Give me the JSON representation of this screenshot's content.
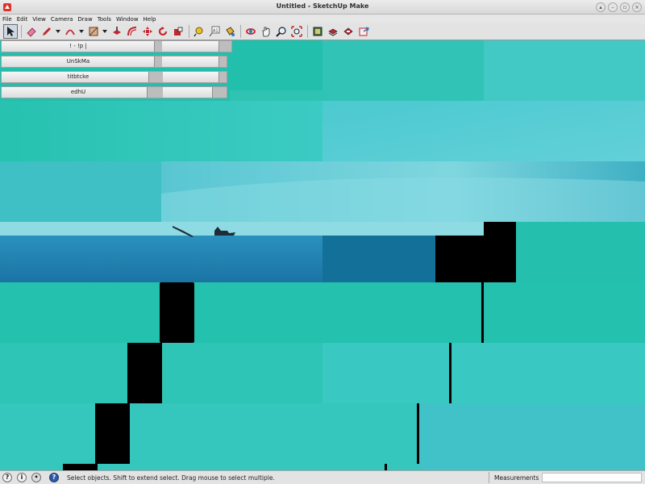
{
  "window": {
    "title": "Untitled - SketchUp Make",
    "icon": "sketchup-logo-icon",
    "buttons": [
      "up-icon",
      "minimize-icon",
      "maximize-icon",
      "close-icon"
    ]
  },
  "menu": [
    "File",
    "Edit",
    "View",
    "Camera",
    "Draw",
    "Tools",
    "Window",
    "Help"
  ],
  "toolbar": {
    "tools": [
      {
        "name": "select-tool-button",
        "icon": "arrow-icon",
        "active": true
      },
      {
        "name": "eraser-tool-button",
        "icon": "eraser-icon"
      },
      {
        "name": "pencil-tool-button",
        "icon": "pencil-icon",
        "dropdown": true
      },
      {
        "name": "arc-tool-button",
        "icon": "arc-icon",
        "dropdown": true
      },
      {
        "name": "shapes-tool-button",
        "icon": "rectangle-icon",
        "dropdown": true
      },
      {
        "name": "pushpull-tool-button",
        "icon": "pushpull-icon"
      },
      {
        "name": "offset-tool-button",
        "icon": "offset-icon"
      },
      {
        "name": "move-tool-button",
        "icon": "move-icon"
      },
      {
        "name": "rotate-tool-button",
        "icon": "rotate-icon"
      },
      {
        "name": "scale-tool-button",
        "icon": "scale-icon"
      },
      {
        "name": "tape-measure-tool-button",
        "icon": "tape-measure-icon"
      },
      {
        "name": "text-tool-button",
        "icon": "text-icon"
      },
      {
        "name": "paint-bucket-tool-button",
        "icon": "paint-bucket-icon"
      },
      {
        "name": "orbit-tool-button",
        "icon": "orbit-icon"
      },
      {
        "name": "pan-tool-button",
        "icon": "pan-icon"
      },
      {
        "name": "zoom-tool-button",
        "icon": "zoom-icon"
      },
      {
        "name": "zoom-extents-tool-button",
        "icon": "zoom-extents-icon"
      },
      {
        "name": "warehouse-button",
        "icon": "warehouse-icon"
      },
      {
        "name": "components-button",
        "icon": "components-icon"
      },
      {
        "name": "extension-warehouse-button",
        "icon": "extension-icon"
      },
      {
        "name": "share-model-button",
        "icon": "share-icon"
      }
    ],
    "text_tool_label": "A1"
  },
  "trays": [
    {
      "label": "! - !p |"
    },
    {
      "label": "UnSkMa"
    },
    {
      "label": "titbtcke"
    },
    {
      "label": "edhU"
    }
  ],
  "status": {
    "text": "Select objects. Shift to extend select. Drag mouse to select multiple.",
    "measurements_label": "Measurements",
    "measurements_value": ""
  },
  "colors": {
    "viewport_bg": "#22bfae",
    "sky_blue": "#5ccfd4",
    "ground_blue": "#1a84b0",
    "black": "#000000"
  }
}
